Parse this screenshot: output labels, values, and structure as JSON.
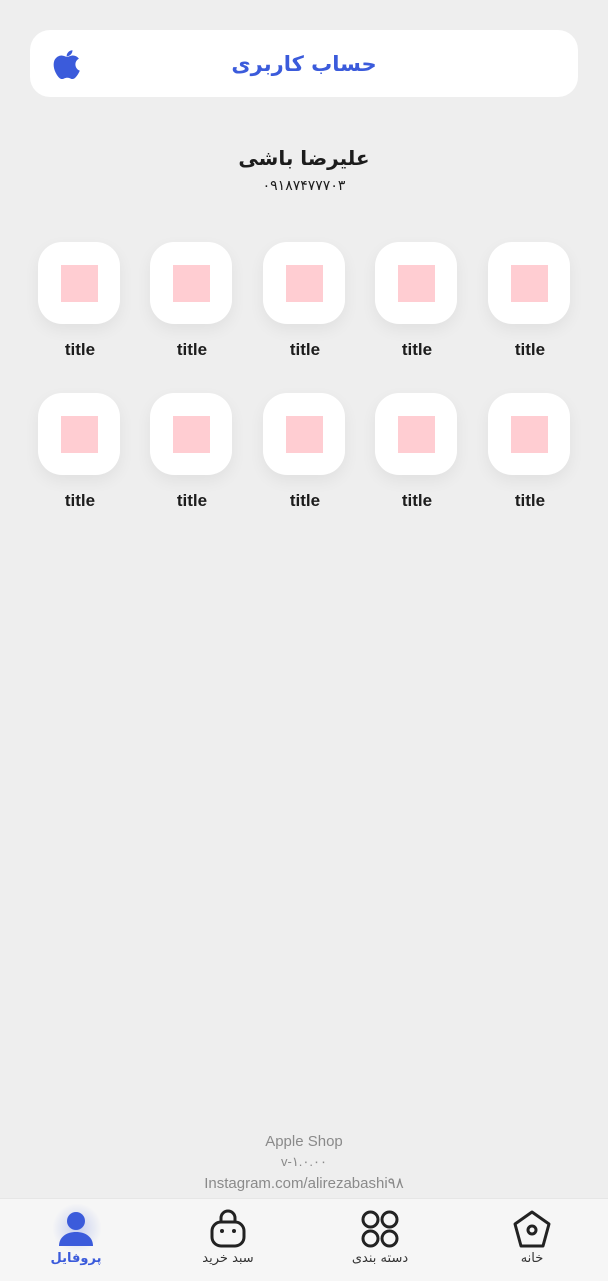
{
  "header": {
    "title": "حساب کاربری",
    "logo_icon": "apple-icon",
    "accent_color": "#3b5bdb"
  },
  "user": {
    "name": "علیرضا باشی",
    "phone": "۰۹۱۸۷۴۷۷۷۰۳"
  },
  "grid": {
    "thumb_color": "#ffcdd2",
    "items": [
      {
        "label": "title"
      },
      {
        "label": "title"
      },
      {
        "label": "title"
      },
      {
        "label": "title"
      },
      {
        "label": "title"
      },
      {
        "label": "title"
      },
      {
        "label": "title"
      },
      {
        "label": "title"
      },
      {
        "label": "title"
      },
      {
        "label": "title"
      }
    ]
  },
  "footer": {
    "brand": "Apple Shop",
    "version": "v-۱.۰.۰۰",
    "social": "Instagram.com/alirezabashi۹۸"
  },
  "nav": {
    "items": [
      {
        "label": "پروفایل",
        "icon": "user-icon",
        "active": true
      },
      {
        "label": "سبد خرید",
        "icon": "shopping-bag-icon",
        "active": false
      },
      {
        "label": "دسته بندی",
        "icon": "category-grid-icon",
        "active": false
      },
      {
        "label": "خانه",
        "icon": "home-icon",
        "active": false
      }
    ]
  }
}
